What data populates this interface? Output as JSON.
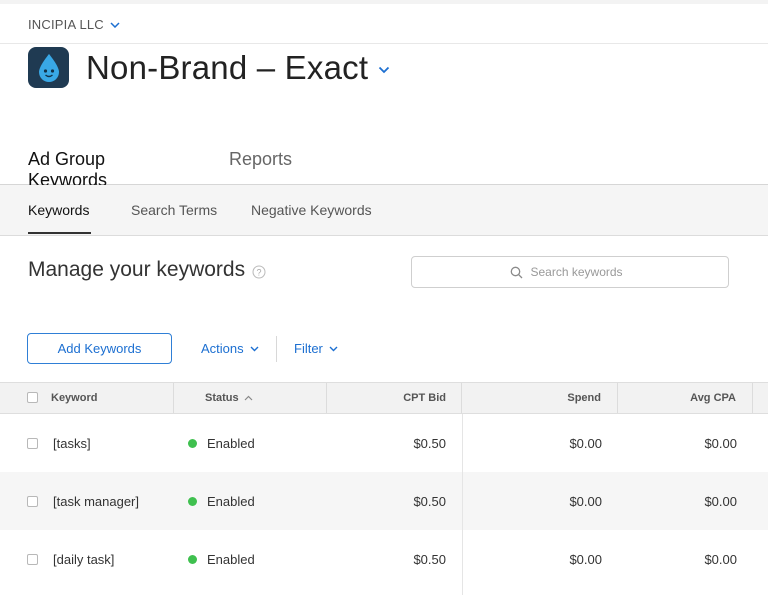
{
  "org": {
    "name": "INCIPIA LLC"
  },
  "ad_group": {
    "title": "Non-Brand – Exact",
    "icon": "droplet-app-icon"
  },
  "main_tabs": [
    {
      "label": "Ad Group Keywords",
      "active": true
    },
    {
      "label": "Reports",
      "active": false
    }
  ],
  "sub_tabs": [
    {
      "label": "Keywords",
      "active": true
    },
    {
      "label": "Search Terms",
      "active": false
    },
    {
      "label": "Negative Keywords",
      "active": false
    }
  ],
  "manage": {
    "title": "Manage your keywords"
  },
  "search": {
    "placeholder": "Search keywords"
  },
  "toolbar": {
    "add_label": "Add Keywords",
    "actions_label": "Actions",
    "filter_label": "Filter"
  },
  "table": {
    "columns": [
      "Keyword",
      "Status",
      "CPT Bid",
      "Spend",
      "Avg CPA"
    ],
    "rows": [
      {
        "keyword": "[tasks]",
        "status": "Enabled",
        "cpt_bid": "$0.50",
        "spend": "$0.00",
        "avg_cpa": "$0.00"
      },
      {
        "keyword": "[task manager]",
        "status": "Enabled",
        "cpt_bid": "$0.50",
        "spend": "$0.00",
        "avg_cpa": "$0.00"
      },
      {
        "keyword": "[daily task]",
        "status": "Enabled",
        "cpt_bid": "$0.50",
        "spend": "$0.00",
        "avg_cpa": "$0.00"
      }
    ]
  },
  "colors": {
    "accent": "#1c6fd1",
    "status_enabled": "#3fc04f",
    "app_icon_bg": "#1f3a52",
    "droplet": "#39a8e6"
  }
}
